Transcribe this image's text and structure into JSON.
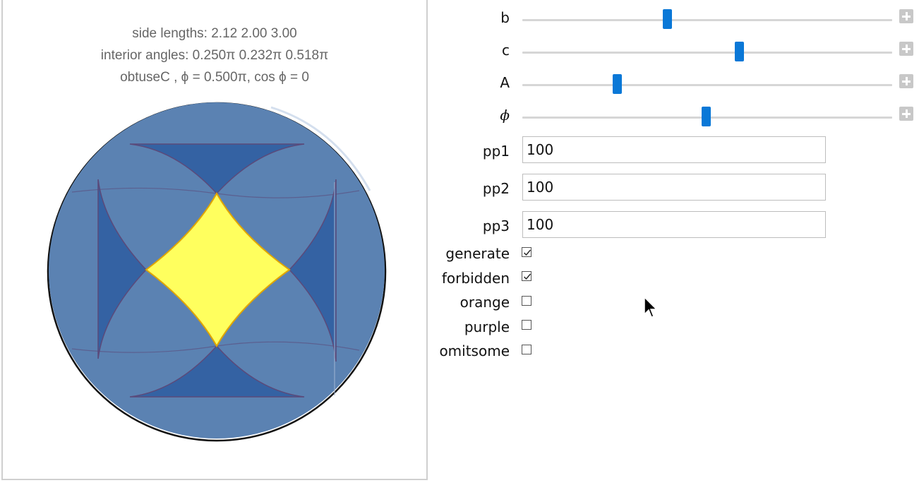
{
  "plot": {
    "line1": "side lengths: 2.12  2.00  3.00",
    "line2": "interior angles: 0.250π  0.232π  0.518π",
    "line3": "obtuseC ,   ϕ = 0.500π,  cos ϕ = 0",
    "colors": {
      "disk": "#5b82b2",
      "dark": "#3462a3",
      "center": "#ffff5e",
      "centerStroke": "#e0a500"
    }
  },
  "controls": {
    "sliders": [
      {
        "label": "b",
        "value": 0.39
      },
      {
        "label": "c",
        "value": 0.59
      },
      {
        "label": "A",
        "value": 0.25
      },
      {
        "label": "ϕ",
        "value": 0.497
      }
    ],
    "fields": [
      {
        "label": "pp1",
        "value": "100"
      },
      {
        "label": "pp2",
        "value": "100"
      },
      {
        "label": "pp3",
        "value": "100"
      }
    ],
    "checkboxes": [
      {
        "label": "generate",
        "checked": true
      },
      {
        "label": "forbidden",
        "checked": true
      },
      {
        "label": "orange",
        "checked": false
      },
      {
        "label": "purple",
        "checked": false
      },
      {
        "label": "omitsome",
        "checked": false
      }
    ],
    "accent": "#0a78d7"
  }
}
